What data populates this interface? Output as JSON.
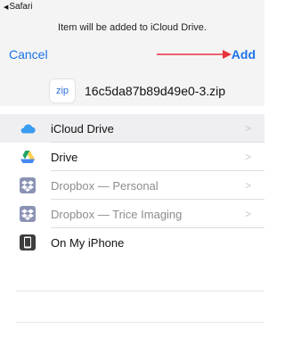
{
  "status_bar": {
    "back_label": "Safari"
  },
  "header": {
    "notice": "Item will be added to iCloud Drive.",
    "cancel_label": "Cancel",
    "add_label": "Add",
    "accent_color": "#1a73e8",
    "arrow_color": "#e8323c"
  },
  "file": {
    "icon_text": "zip",
    "name": "16c5da87b89d49e0-3.zip"
  },
  "locations": [
    {
      "label": "iCloud Drive",
      "icon": "icloud-icon",
      "selected": true,
      "dimmed": false
    },
    {
      "label": "Drive",
      "icon": "google-drive-icon",
      "selected": false,
      "dimmed": false
    },
    {
      "label": "Dropbox — Personal",
      "icon": "dropbox-icon",
      "selected": false,
      "dimmed": true
    },
    {
      "label": "Dropbox — Trice Imaging",
      "icon": "dropbox-icon",
      "selected": false,
      "dimmed": true
    },
    {
      "label": "On My iPhone",
      "icon": "iphone-icon",
      "selected": false,
      "dimmed": false
    }
  ],
  "chevron": ">"
}
